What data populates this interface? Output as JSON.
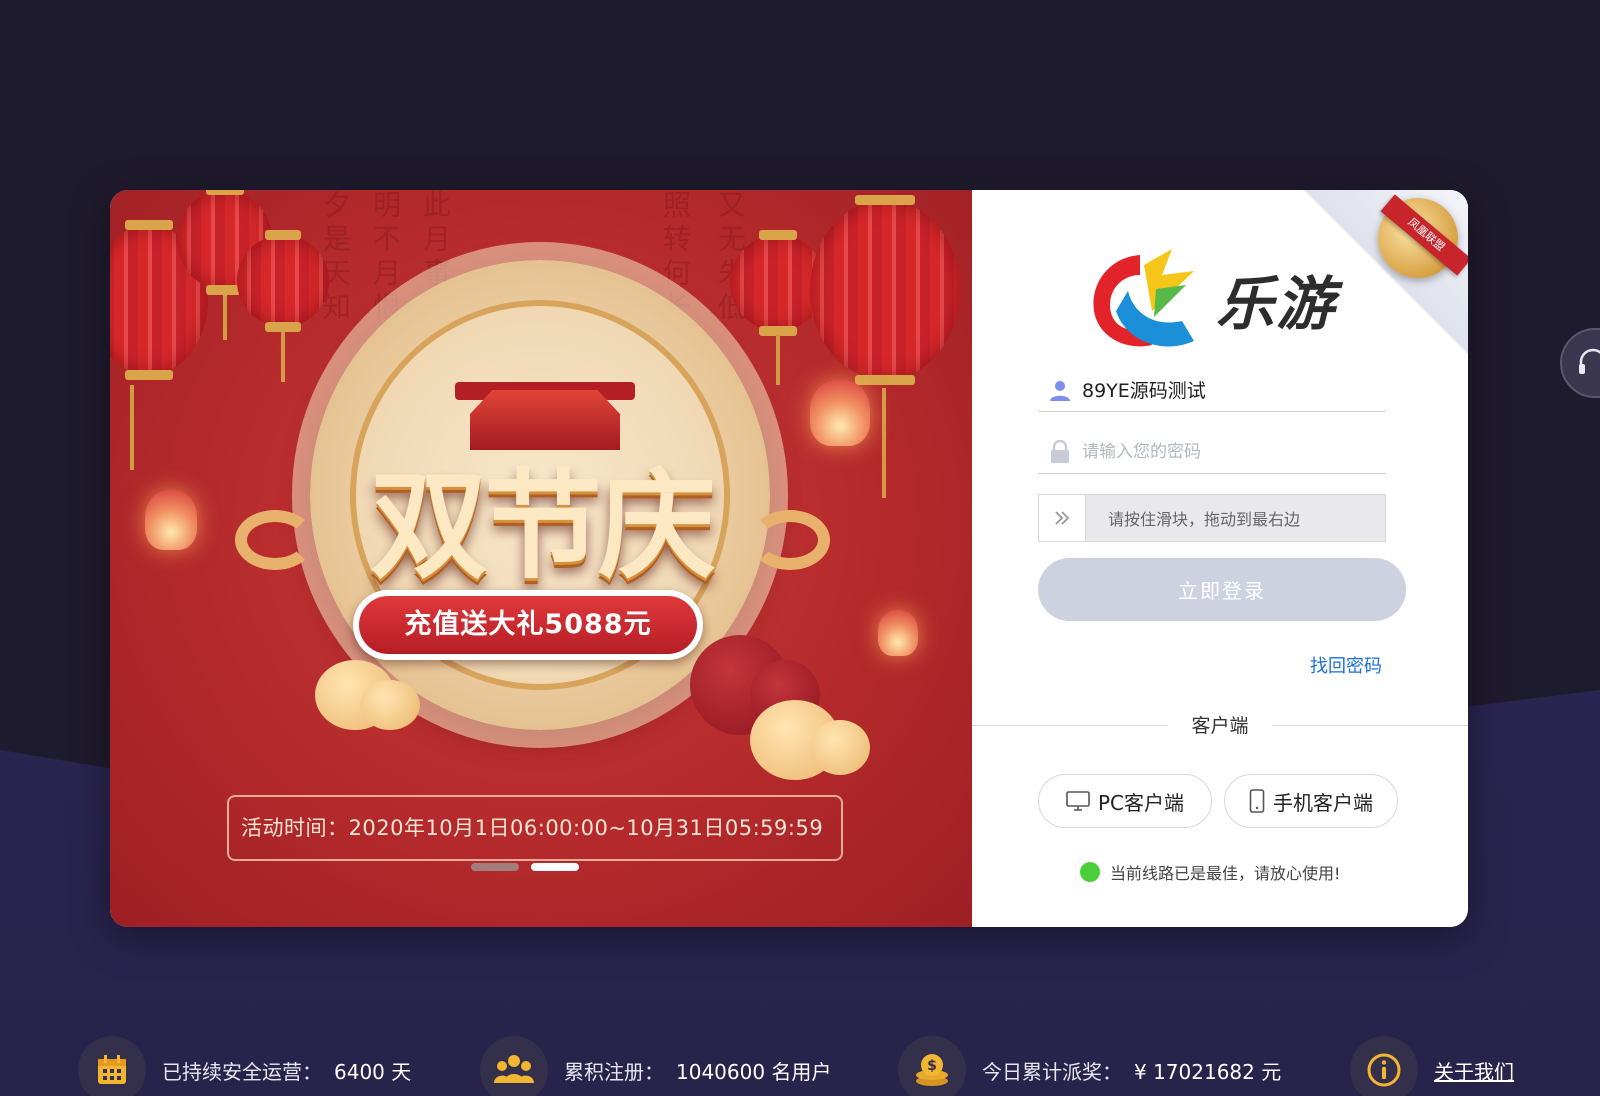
{
  "banner": {
    "title": "双节庆",
    "promo": "充值送大礼5088元",
    "time": "活动时间：2020年10月1日06:00:00~10月31日05:59:59",
    "slides": [
      {
        "active": false
      },
      {
        "active": true
      }
    ]
  },
  "logo": {
    "text": "乐游",
    "badge": "凤凰联盟"
  },
  "login": {
    "username_value": "89YE源码测试",
    "password_placeholder": "请输入您的密码",
    "slider_text": "请按住滑块，拖动到最右边",
    "submit_label": "立即登录",
    "forgot_label": "找回密码",
    "client_divider": "客户端",
    "pc_client_label": "PC客户端",
    "mobile_client_label": "手机客户端",
    "status_text": "当前线路已是最佳，请放心使用!"
  },
  "stats": {
    "uptime_label": "已持续安全运营：",
    "uptime_value": "6400 天",
    "register_label": "累积注册：",
    "register_value": "1040600 名用户",
    "payout_label": "今日累计派奖：",
    "payout_value": "¥  17021682 元",
    "about_label": "关于我们"
  },
  "icons": {
    "user": "user-icon",
    "lock": "lock-icon",
    "slider": "double-chevron-right-icon",
    "pc": "monitor-icon",
    "mobile": "phone-icon",
    "calendar": "calendar-icon",
    "users": "users-icon",
    "coins": "coins-icon",
    "info": "info-icon",
    "support": "headset-icon"
  },
  "colors": {
    "page_bg": "#1f1b2e",
    "banner_red": "#b52a2c",
    "button_disabled": "#ced2e0",
    "link_blue": "#1d6fde",
    "status_green": "#4ccd3a"
  }
}
